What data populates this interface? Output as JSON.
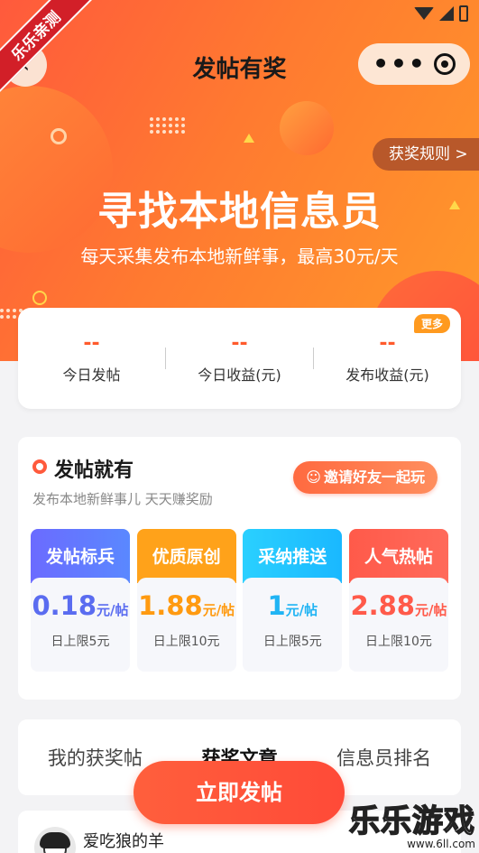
{
  "corner_ribbon": "乐乐亲测",
  "nav": {
    "title": "发帖有奖",
    "back_icon": "‹",
    "more_icon": "•••"
  },
  "banner": {
    "rules_label": "获奖规则 >",
    "headline": "寻找本地信息员",
    "subline": "每天采集发布本地新鲜事，最高30元/天"
  },
  "stats": {
    "more_badge": "更多",
    "items": [
      {
        "value": "--",
        "label": "今日发帖"
      },
      {
        "value": "--",
        "label": "今日收益(元)"
      },
      {
        "value": "--",
        "label": "发布收益(元)"
      }
    ]
  },
  "post_section": {
    "title": "发帖就有",
    "subtitle": "发布本地新鲜事儿 天天赚奖励",
    "invite_label": "邀请好友一起玩",
    "rewards": [
      {
        "name": "发帖标兵",
        "amount": "0.18",
        "unit": "元/帖",
        "limit": "日上限5元",
        "color": "#5a6cf0"
      },
      {
        "name": "优质原创",
        "amount": "1.88",
        "unit": "元/帖",
        "limit": "日上限10元",
        "color": "#ff9a10"
      },
      {
        "name": "采纳推送",
        "amount": "1",
        "unit": "元/帖",
        "limit": "日上限5元",
        "color": "#20b4f4"
      },
      {
        "name": "人气热帖",
        "amount": "2.88",
        "unit": "元/帖",
        "limit": "日上限10元",
        "color": "#ff5a4a"
      }
    ]
  },
  "tabs": [
    {
      "label": "我的获奖帖"
    },
    {
      "label": "获奖文章"
    },
    {
      "label": "信息员排名"
    }
  ],
  "post_button_label": "立即发帖",
  "user": {
    "name": "爱吃狼的羊"
  },
  "watermark": {
    "title": "乐乐游戏",
    "url": "www.6ll.com"
  },
  "colors": {
    "accent": "#ff5a3c",
    "orange": "#ff9a2a"
  }
}
